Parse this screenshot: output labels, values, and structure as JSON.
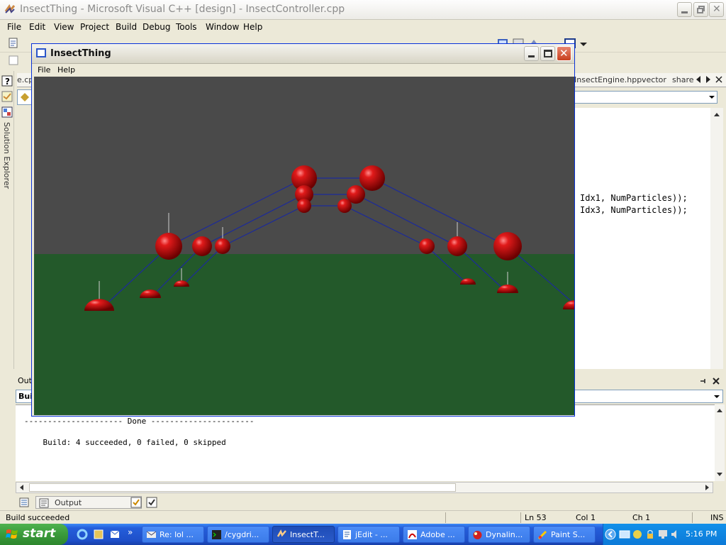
{
  "vs": {
    "title": "InsectThing - Microsoft Visual C++ [design] - InsectController.cpp",
    "menu": [
      "File",
      "Edit",
      "View",
      "Project",
      "Build",
      "Debug",
      "Tools",
      "Window",
      "Help"
    ],
    "left_strip": {
      "label": "Solution Explorer"
    },
    "tabs": [
      "e.cp",
      "InsectEngine.hpp",
      "vector",
      "share"
    ],
    "code_lines": [
      "Idx1, NumParticles));",
      "Idx3, NumParticles));"
    ],
    "output": {
      "header": "Outp",
      "combo_value": "Build",
      "lines": [
        "--------------------- Done ----------------------",
        "    Build: 4 succeeded, 0 failed, 0 skipped"
      ],
      "tab_label": "Output"
    },
    "status": {
      "message": "Build succeeded",
      "line": "Ln 53",
      "col": "Col 1",
      "ch": "Ch 1",
      "mode": "INS"
    }
  },
  "app": {
    "title": "InsectThing",
    "menu": [
      "File",
      "Help"
    ],
    "sky_color": "#4a4a4a",
    "ground_color": "#23592a",
    "sphere_color": "#d01010",
    "link_color": "#1c2a9a"
  },
  "taskbar": {
    "start_label": "start",
    "tasks": [
      {
        "label": "Re: lol ...",
        "icon": "mail-icon"
      },
      {
        "label": "/cygdri...",
        "icon": "terminal-icon"
      },
      {
        "label": "InsectT...",
        "icon": "vs-icon"
      },
      {
        "label": "jEdit - ...",
        "icon": "jedit-icon"
      },
      {
        "label": "Adobe ...",
        "icon": "adobe-icon"
      },
      {
        "label": "Dynalin...",
        "icon": "dynalink-icon"
      },
      {
        "label": "Paint S...",
        "icon": "paint-icon"
      }
    ],
    "clock": "5:16 PM"
  }
}
